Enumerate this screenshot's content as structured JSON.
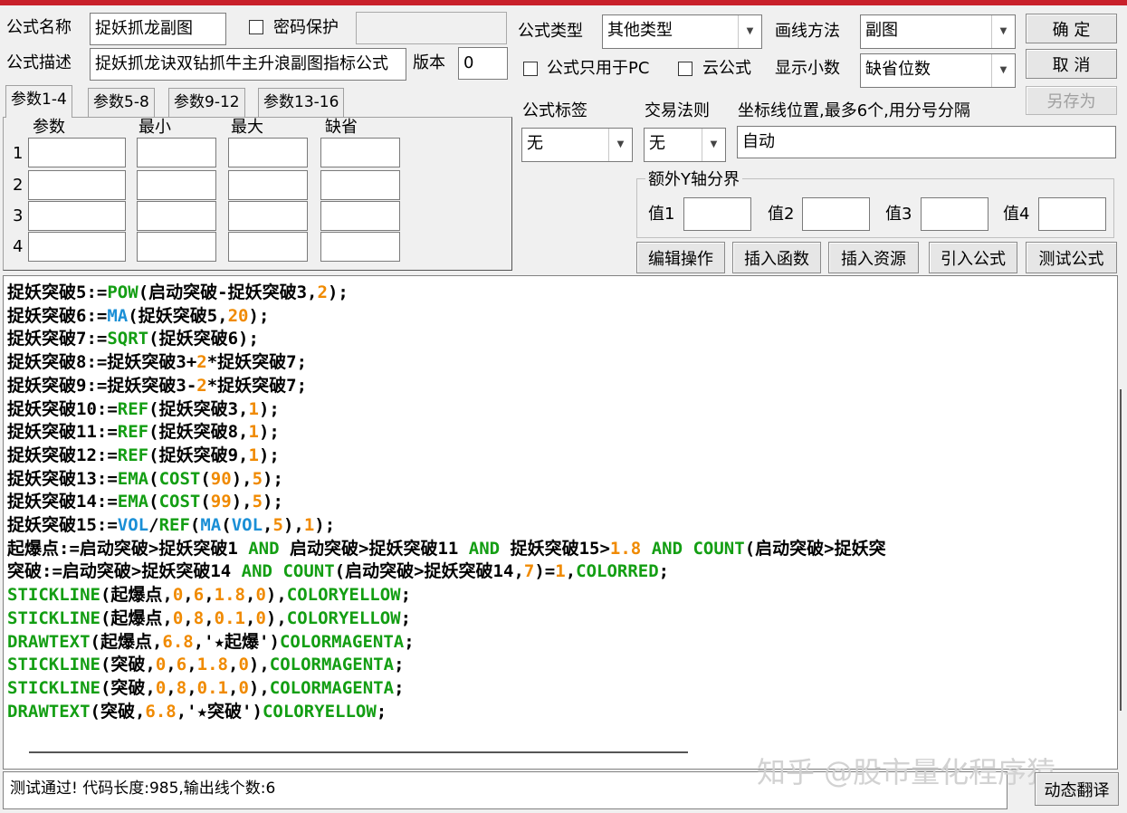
{
  "form": {
    "name_label": "公式名称",
    "name_value": "捉妖抓龙副图",
    "password_label": "密码保护",
    "desc_label": "公式描述",
    "desc_value": "捉妖抓龙诀双钻抓牛主升浪副图指标公式",
    "version_label": "版本",
    "version_value": "0",
    "type_label": "公式类型",
    "type_value": "其他类型",
    "draw_label": "画线方法",
    "draw_value": "副图",
    "pc_only_label": "公式只用于PC",
    "cloud_label": "云公式",
    "decimals_label": "显示小数",
    "decimals_value": "缺省位数",
    "tag_label": "公式标签",
    "tag_value": "无",
    "trade_label": "交易法则",
    "trade_value": "无",
    "coord_label": "坐标线位置,最多6个,用分号分隔",
    "coord_value": "自动",
    "yaxis_label": "额外Y轴分界",
    "y_labels": [
      "值1",
      "值2",
      "值3",
      "值4"
    ]
  },
  "buttons": {
    "ok": "确 定",
    "cancel": "取 消",
    "save_as": "另存为",
    "edit": "编辑操作",
    "insert_func": "插入函数",
    "insert_res": "插入资源",
    "import": "引入公式",
    "test": "测试公式",
    "translate": "动态翻译"
  },
  "tabs": [
    "参数1-4",
    "参数5-8",
    "参数9-12",
    "参数13-16"
  ],
  "param_headers": [
    "参数",
    "最小",
    "最大",
    "缺省"
  ],
  "param_rows": [
    "1",
    "2",
    "3",
    "4"
  ],
  "code_lines": [
    "捉妖突破5:=POW(启动突破-捉妖突破3,2);",
    "捉妖突破6:=MA(捉妖突破5,20);",
    "捉妖突破7:=SQRT(捉妖突破6);",
    "捉妖突破8:=捉妖突破3+2*捉妖突破7;",
    "捉妖突破9:=捉妖突破3-2*捉妖突破7;",
    "捉妖突破10:=REF(捉妖突破3,1);",
    "捉妖突破11:=REF(捉妖突破8,1);",
    "捉妖突破12:=REF(捉妖突破9,1);",
    "捉妖突破13:=EMA(COST(90),5);",
    "捉妖突破14:=EMA(COST(99),5);",
    "捉妖突破15:=VOL/REF(MA(VOL,5),1);",
    "起爆点:=启动突破>捉妖突破1 AND 启动突破>捉妖突破11 AND 捉妖突破15>1.8 AND COUNT(启动突破>捉妖突",
    "突破:=启动突破>捉妖突破14 AND COUNT(启动突破>捉妖突破14,7)=1,COLORRED;",
    "STICKLINE(起爆点,0,6,1.8,0),COLORYELLOW;",
    "STICKLINE(起爆点,0,8,0.1,0),COLORYELLOW;",
    "DRAWTEXT(起爆点,6.8,'★起爆')COLORMAGENTA;",
    "STICKLINE(突破,0,6,1.8,0),COLORMAGENTA;",
    "STICKLINE(突破,0,8,0.1,0),COLORMAGENTA;",
    "DRAWTEXT(突破,6.8,'★突破')COLORYELLOW;"
  ],
  "status_text": "测试通过! 代码长度:985,输出线个数:6",
  "watermark": "知乎 @股市量化程序猿",
  "colors": {
    "function": "#139e13",
    "builtin_blue": "#1a8fd6",
    "number": "#f08a00",
    "title_bar": "#c8202a"
  }
}
